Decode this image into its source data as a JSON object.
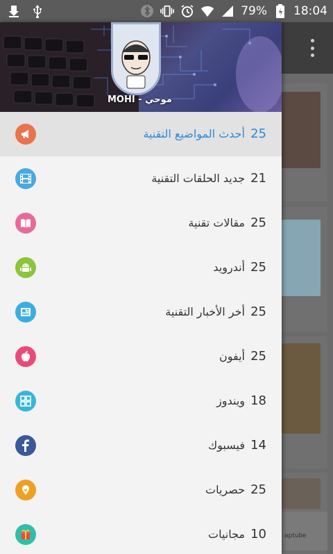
{
  "statusbar": {
    "battery_percent": "79%",
    "time": "18:04",
    "icons": [
      "download-done-icon",
      "usb-icon",
      "bluetooth-icon",
      "vibrate-icon",
      "alarm-icon",
      "wifi-icon",
      "signal-icon",
      "battery-icon"
    ]
  },
  "header": {
    "name": "MOHI - موحي"
  },
  "menu": {
    "items": [
      {
        "label": "أحدث المواضيع التقنية",
        "count": "25",
        "icon": "megaphone-icon",
        "color": "#e8734d"
      },
      {
        "label": "جديد الحلقات التقنية",
        "count": "21",
        "icon": "film-icon",
        "color": "#49a9e0"
      },
      {
        "label": "مقالات تقنية",
        "count": "25",
        "icon": "book-icon",
        "color": "#e86a9a"
      },
      {
        "label": "أندرويد",
        "count": "25",
        "icon": "android-icon",
        "color": "#8cc43c"
      },
      {
        "label": "أخر الأخبار التقنية",
        "count": "25",
        "icon": "newspaper-icon",
        "color": "#3aaee0"
      },
      {
        "label": "أيفون",
        "count": "25",
        "icon": "apple-icon",
        "color": "#ea4a7a"
      },
      {
        "label": "ويندوز",
        "count": "18",
        "icon": "windows-icon",
        "color": "#38b6d9"
      },
      {
        "label": "فيسبوك",
        "count": "14",
        "icon": "facebook-icon",
        "color": "#3b5998"
      },
      {
        "label": "حصريات",
        "count": "25",
        "icon": "exclusive-icon",
        "color": "#f0a020"
      },
      {
        "label": "مجانيات",
        "count": "10",
        "icon": "gift-icon",
        "color": "#2fbfa8"
      }
    ]
  },
  "background": {
    "card_label": "aptube"
  }
}
